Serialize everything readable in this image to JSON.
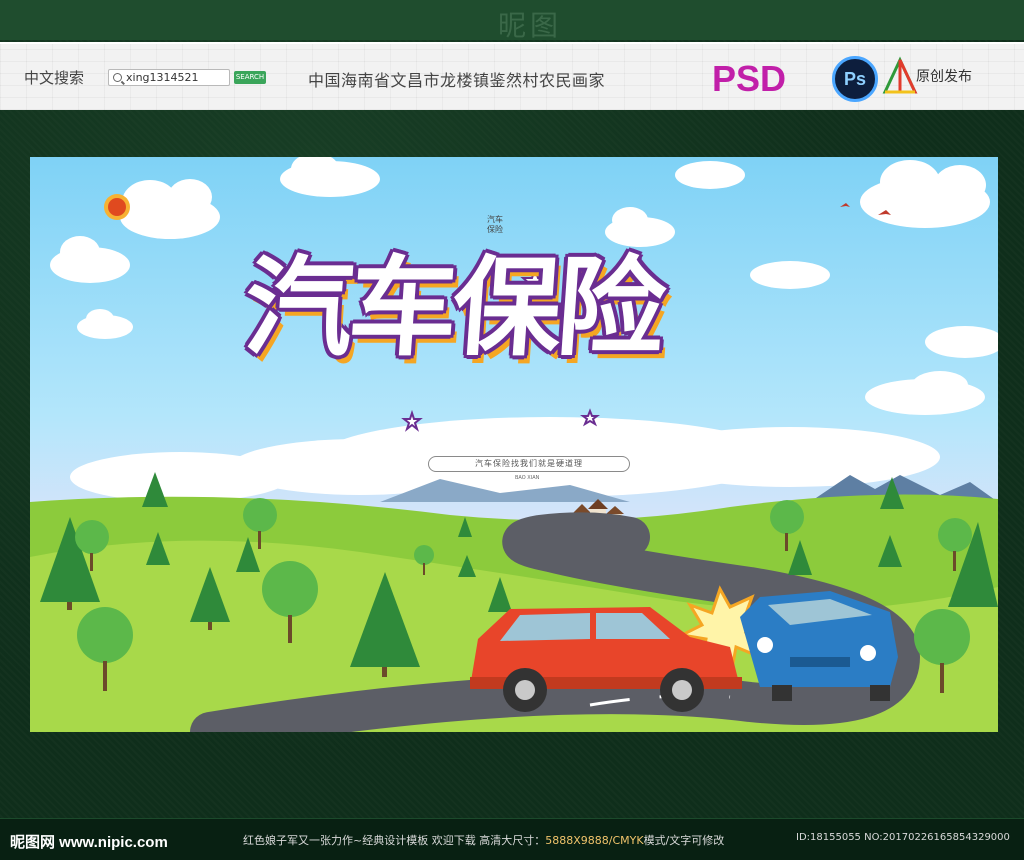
{
  "header": {
    "watermark_glyph": "昵图"
  },
  "banner": {
    "search_label": "中文搜索",
    "search_value": "xing1314521",
    "search_button": "SEARCH",
    "title": "中国海南省文昌市龙楼镇鉴然村农民画家",
    "format_badge": "PSD",
    "ps_icon_text": "Ps",
    "original_label": "原创发布"
  },
  "poster": {
    "main_title": "汽车保险",
    "small_logo_lines": [
      "汽车",
      "保险"
    ],
    "slogan": "汽车保险找我们就是硬道理",
    "small_caption": "BAO XIAN",
    "colors": {
      "title_outline": "#6a2d91",
      "title_shadow": "#f5a623",
      "sky_top": "#7fd2f6",
      "grass": "#8ccb3c",
      "red_car": "#e8452a",
      "blue_car": "#2b7dc5",
      "road": "#5c5e66"
    }
  },
  "footer": {
    "site": "昵图网 www.nipic.com",
    "desc_prefix": "红色娘子军又一张力作~经典设计模板  欢迎下载  高清大尺寸：",
    "desc_size": "5888X9888/CMYK",
    "desc_suffix": "模式/文字可修改",
    "id_text": "ID:18155055 NO:20170226165854329000"
  }
}
